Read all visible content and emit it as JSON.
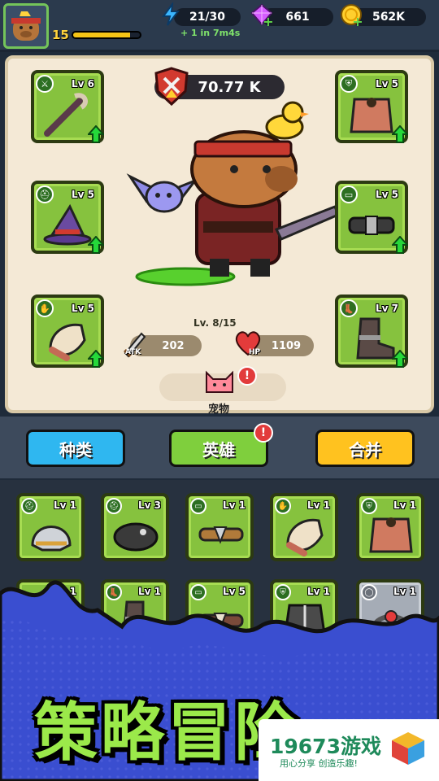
{
  "header": {
    "player_level": "15",
    "xp_progress": 0.85,
    "energy": "21/30",
    "energy_regen": "+ 1 in 7m4s",
    "gems": "661",
    "gold": "562K"
  },
  "hero": {
    "power": "70.77 K",
    "level": "Lv. 8/15",
    "atk_label": "ATK",
    "atk": "202",
    "hp_label": "HP",
    "hp": "1109",
    "pet_label": "宠物",
    "slots": [
      {
        "level": "Lv 6",
        "item": "staff"
      },
      {
        "level": "Lv 5",
        "item": "wizard-hat"
      },
      {
        "level": "Lv 5",
        "item": "fur-glove"
      },
      {
        "level": "Lv 5",
        "item": "fur-armor"
      },
      {
        "level": "Lv 5",
        "item": "belt"
      },
      {
        "level": "Lv 7",
        "item": "boot"
      }
    ]
  },
  "tabs": [
    {
      "label": "种类",
      "color": "#2fb7f0"
    },
    {
      "label": "英雄",
      "color": "#7fcf3d",
      "badge": "!"
    },
    {
      "label": "合并",
      "color": "#ffc21f"
    }
  ],
  "inventory": [
    {
      "level": "Lv 1",
      "item": "helmet"
    },
    {
      "level": "Lv 3",
      "item": "cap"
    },
    {
      "level": "Lv 1",
      "item": "belt"
    },
    {
      "level": "Lv 1",
      "item": "fur-glove"
    },
    {
      "level": "Lv 1",
      "item": "fur-armor"
    },
    {
      "level": "Lv 1",
      "item": "boot"
    },
    {
      "level": "Lv 1",
      "item": "boot"
    },
    {
      "level": "Lv 5",
      "item": "belt"
    },
    {
      "level": "Lv 1",
      "item": "jacket"
    },
    {
      "level": "Lv 1",
      "item": "ring"
    }
  ],
  "banner": {
    "title": "策略冒险",
    "watermark_title": "19673游戏",
    "watermark_sub": "用心分享 创造乐趣!"
  }
}
